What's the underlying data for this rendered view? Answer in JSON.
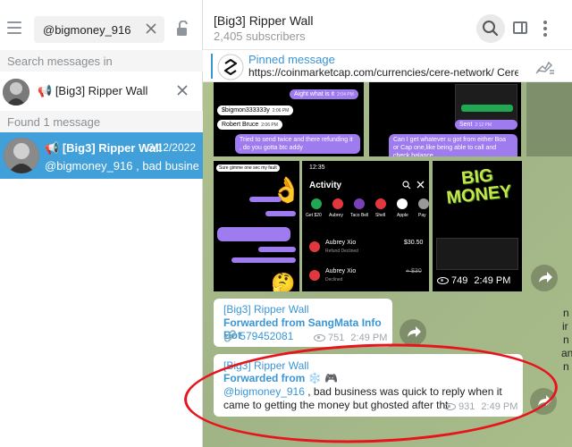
{
  "search": {
    "query": "@bigmoney_916",
    "search_in_label": "Search messages in",
    "chat_name": "[Big3] Ripper Wall",
    "found_label": "Found 1 message"
  },
  "result": {
    "name": "[Big3] Ripper Wall",
    "date": "2/12/2022",
    "preview": "@bigmoney_916 , bad business ..."
  },
  "header": {
    "title": "[Big3] Ripper Wall",
    "subscribers": "2,405 subscribers"
  },
  "pinned": {
    "title": "Pinned message",
    "text": "https://coinmarketcap.com/currencies/cere-network/  Cere..."
  },
  "media": {
    "chat1": {
      "msg1": "Aight what is it",
      "msg2": "$bigmon333333y",
      "msg3": "Robert Bruce",
      "msg4": "Tried to send twice and there refunding it , do you gotta btc addy"
    },
    "chat2": {
      "sent": "Sent",
      "msg": "Can I get whatever u got from either Boa or Cap one,like being able to call and check balance"
    },
    "activity": {
      "time": "12:35",
      "title": "Activity",
      "contacts": [
        "Get $20",
        "Aubrey",
        "Taco Bell",
        "Shell",
        "Apple",
        "Pay"
      ],
      "rows": [
        {
          "name": "Aubrey Xio",
          "status": "Refund Declined",
          "amount": "$30.50"
        },
        {
          "name": "Aubrey Xio",
          "status": "Declined",
          "amount": "+ $30"
        }
      ]
    },
    "bigmoney": {
      "logo_text": "BIG MONEY",
      "views": "749",
      "time": "2:49 PM"
    }
  },
  "messages": [
    {
      "author": "[Big3] Ripper Wall",
      "forwarded": "Forwarded from SangMata Info Bot",
      "link": "579452081",
      "views": "751",
      "time": "2:49 PM"
    },
    {
      "author": "[Big3] Ripper Wall",
      "forwarded": "Forwarded from",
      "forwarded_icons": "❄️ 🎮",
      "mention": "@bigmoney_916",
      "text": " , bad business was quick to reply when it came to getting the money but ghosted after tht",
      "views": "931",
      "time": "2:49 PM"
    }
  ],
  "edge_letters": [
    "n",
    "ir",
    "n",
    "an",
    "n"
  ],
  "colors": {
    "accent": "#419fd9",
    "link": "#3a95d5",
    "annotation": "#e8141b"
  }
}
